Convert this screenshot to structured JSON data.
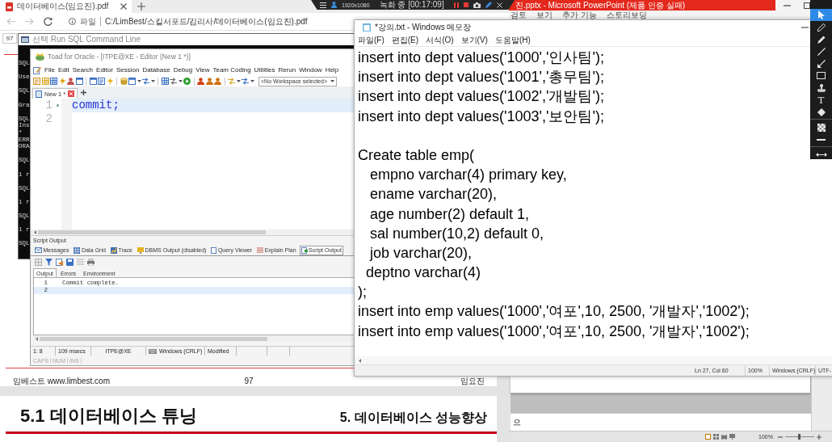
{
  "browser": {
    "tab": {
      "title": "데이터베이스(임요진).pdf"
    },
    "address": {
      "scheme": "파일",
      "path": "C:/LimBest/스킬서포드/김리사/데이터베이스(임요진).pdf"
    },
    "page_field": "97"
  },
  "pdf": {
    "footer": {
      "brand": "임베스트 www.limbest.com",
      "page": "97",
      "author": "임요진"
    },
    "next_page": {
      "section": "5.1 데이터베이스 튜닝",
      "chapter": "5. 데이터베이스 성능향상"
    }
  },
  "recorder": {
    "resolution": "1920x1080",
    "status": "녹화 중 [00:17:09]"
  },
  "powerpoint": {
    "title": "진.pptx - Microsoft PowerPoint (제품 인증 실패)",
    "ribbon_tabs": [
      "검토",
      "보기",
      "추가 기능",
      "스토리보딩"
    ],
    "notes_text": "으",
    "zoom": "100%",
    "zoom_slider": {
      "level": 0.5
    }
  },
  "console": {
    "title": "선택 Run SQL Command Line",
    "blocks": [
      [
        "SQL"
      ],
      [
        "Use"
      ],
      [
        "SQL"
      ],
      [
        "Gra"
      ],
      [
        "SQL",
        "Ins",
        "*",
        "ERR",
        "ORA"
      ],
      [
        "SQL"
      ],
      [
        "1 r"
      ],
      [
        "SQL"
      ],
      [
        "1 r"
      ],
      [
        "SQL"
      ],
      [
        "1 r"
      ],
      [
        "SQL"
      ]
    ]
  },
  "toad": {
    "title": "Toad for Oracle - [ITPE@XE - Editor (New 1 *)]",
    "menu": [
      "File",
      "Edit",
      "Search",
      "Editor",
      "Session",
      "Database",
      "Debug",
      "View",
      "Team Coding",
      "Utilities",
      "Rerun",
      "Window",
      "Help"
    ],
    "workspace": "<No Workspace selected>",
    "editor_tabs": [
      {
        "label": "New 1 *",
        "selected": true
      }
    ],
    "editor_lines": [
      {
        "number": "1",
        "text": "commit;",
        "current": true
      },
      {
        "number": "2",
        "current": false
      }
    ],
    "output": {
      "title": "Script Output",
      "tabs": [
        {
          "label": "Messages",
          "selected": false
        },
        {
          "label": "Data Grid",
          "selected": false
        },
        {
          "label": "Trace",
          "selected": false
        },
        {
          "label": "DBMS Output (disabled)",
          "selected": false
        },
        {
          "label": "Query Viewer",
          "selected": false
        },
        {
          "label": "Explain Plan",
          "selected": false
        },
        {
          "label": "Script Output",
          "selected": true
        }
      ],
      "subtabs": [
        {
          "label": "Output",
          "selected": true
        },
        {
          "label": "Errors",
          "selected": false
        },
        {
          "label": "Environment",
          "selected": false
        }
      ],
      "lines": [
        {
          "number": "1",
          "text": "Commit complete.",
          "current": false
        },
        {
          "number": "2",
          "current": true
        }
      ]
    },
    "status_bar": [
      {
        "kind": "plain",
        "text": "1: 8"
      },
      {
        "kind": "plain",
        "text": "109 msecs"
      },
      {
        "kind": "centered",
        "text": "ITPE@XE"
      },
      {
        "kind": "keyboard",
        "text": "Windows (CRLF)"
      },
      {
        "kind": "plain",
        "text": "Modified"
      }
    ],
    "indicators": [
      {
        "label": "CAPS",
        "on": false
      },
      {
        "label": "NUM",
        "on": false
      },
      {
        "label": "INS",
        "on": false
      }
    ]
  },
  "notepad": {
    "title": "*강의.txt - Windows 메모장",
    "menu": [
      "파일(F)",
      "편집(E)",
      "서식(O)",
      "보기(V)",
      "도움말(H)"
    ],
    "paragraphs": [
      [
        "insert into dept values('1000','인사팀');",
        "insert into dept values('1001','총무팀');",
        "insert into dept values('1002','개발팀');",
        "insert into dept values('1003','보안팀');"
      ],
      [
        "Create table emp(",
        "   empno varchar(4) primary key,",
        "   ename varchar(20),",
        "   age number(2) default 1,",
        "   sal number(10,2) default 0,",
        "   job varchar(20),",
        "  deptno varchar(4)",
        ");",
        "insert into emp values('1000','여포',10, 2500, '개발자','1002');",
        "insert into emp values('1000','여포',10, 2500, '개발자','1002');"
      ]
    ],
    "status": [
      "Ln 27, Col 60",
      "100%",
      "Windows (CRLF)",
      "UTF-"
    ]
  },
  "annotation_toolbar": {
    "groups": [
      [
        {
          "kind": "cursor",
          "selected": true
        },
        {
          "kind": "pencil",
          "selected": false
        },
        {
          "kind": "marker",
          "selected": false
        },
        {
          "kind": "line",
          "selected": false
        },
        {
          "kind": "arrow",
          "selected": false
        },
        {
          "kind": "rectangle",
          "selected": false
        },
        {
          "kind": "stamp",
          "selected": false
        },
        {
          "kind": "text",
          "label": "T",
          "selected": false
        },
        {
          "kind": "eraser",
          "selected": false
        }
      ],
      [
        {
          "kind": "fill",
          "selected": false
        },
        {
          "kind": "line-width",
          "selected": false
        }
      ],
      [
        {
          "kind": "arrows",
          "selected": false
        }
      ]
    ]
  }
}
